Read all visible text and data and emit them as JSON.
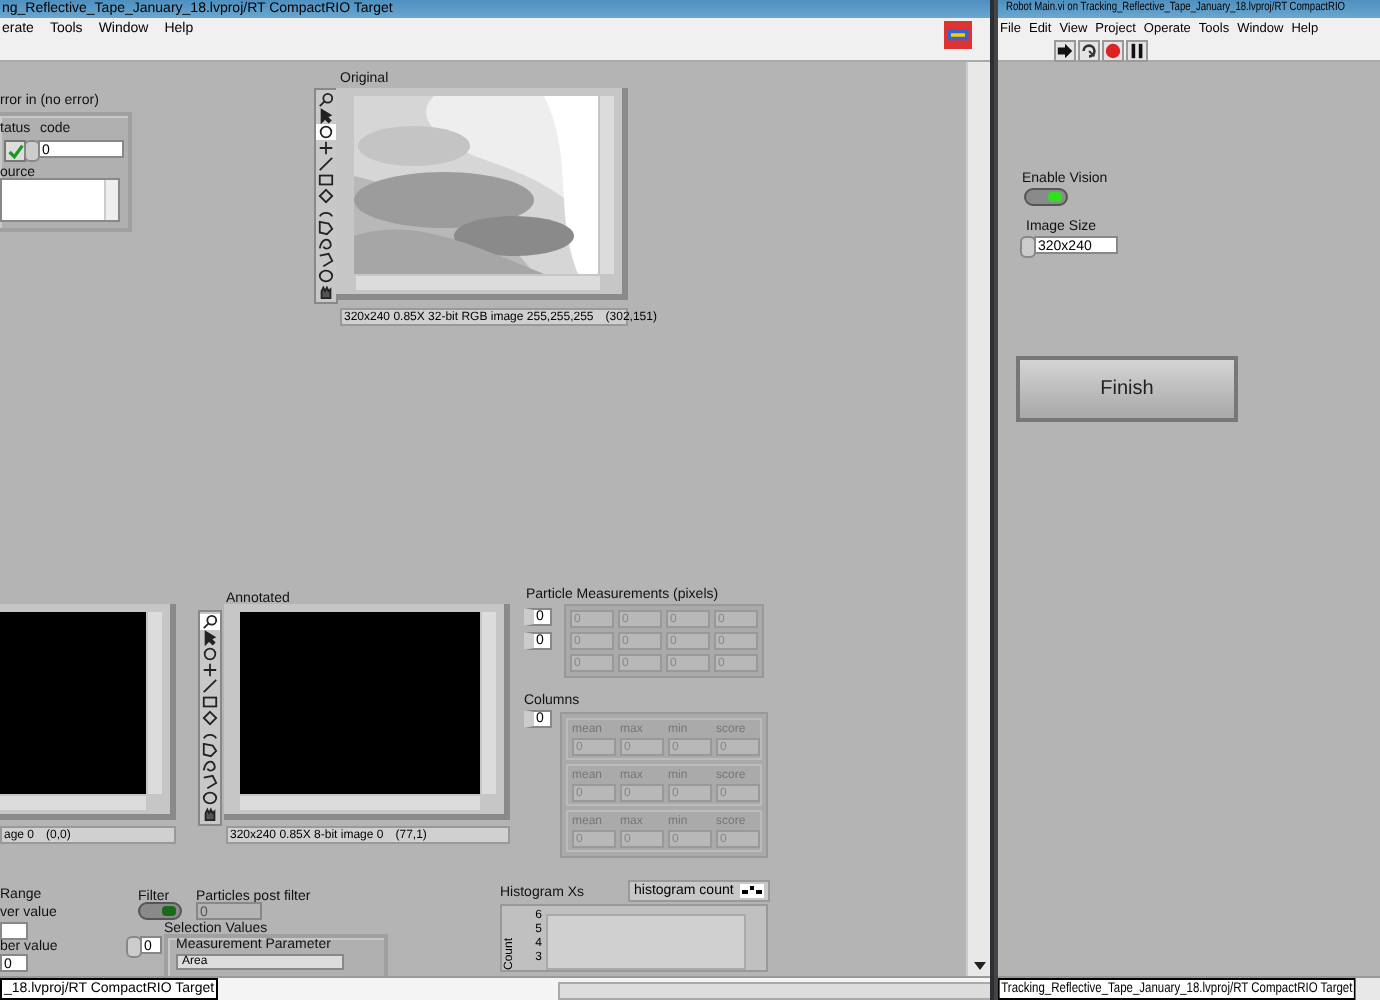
{
  "left_window": {
    "title": "ng_Reflective_Tape_January_18.lvproj/RT CompactRIO Target",
    "menu": [
      "erate",
      "Tools",
      "Window",
      "Help"
    ],
    "status": "_18.lvproj/RT CompactRIO Target"
  },
  "error_in": {
    "label": "rror in (no error)",
    "status_label": "tatus",
    "code_label": "code",
    "status": true,
    "code": "0",
    "source_label": "ource"
  },
  "original": {
    "label": "Original",
    "info": "320x240 0.85X 32-bit RGB image 255,255,255",
    "coords": "(302,151)",
    "tools": [
      {
        "kind": "zoom",
        "selected": false
      },
      {
        "kind": "pointer",
        "selected": false
      },
      {
        "kind": "pan",
        "selected": true
      },
      {
        "kind": "point",
        "selected": false
      },
      {
        "kind": "line",
        "selected": false
      },
      {
        "kind": "rectangle",
        "selected": false
      },
      {
        "kind": "rotated",
        "selected": false
      },
      {
        "kind": "annulus",
        "selected": false
      },
      {
        "kind": "polygon",
        "selected": false
      },
      {
        "kind": "freehand",
        "selected": false
      },
      {
        "kind": "broken",
        "selected": false
      },
      {
        "kind": "oval",
        "selected": false
      },
      {
        "kind": "hand",
        "selected": false
      }
    ]
  },
  "left_display": {
    "info": "age 0",
    "coords": "(0,0)"
  },
  "annotated": {
    "label": "Annotated",
    "info": "320x240 0.85X 8-bit image 0",
    "coords": "(77,1)",
    "tools": [
      {
        "kind": "zoom",
        "selected": true
      },
      {
        "kind": "pointer",
        "selected": false
      },
      {
        "kind": "pan",
        "selected": false
      },
      {
        "kind": "point",
        "selected": false
      },
      {
        "kind": "line",
        "selected": false
      },
      {
        "kind": "rectangle",
        "selected": false
      },
      {
        "kind": "rotated",
        "selected": false
      },
      {
        "kind": "annulus",
        "selected": false
      },
      {
        "kind": "polygon",
        "selected": false
      },
      {
        "kind": "freehand",
        "selected": false
      },
      {
        "kind": "broken",
        "selected": false
      },
      {
        "kind": "oval",
        "selected": false
      },
      {
        "kind": "hand",
        "selected": false
      }
    ]
  },
  "particle_measurements": {
    "label": "Particle Measurements (pixels)",
    "indices": [
      "0",
      "0"
    ],
    "rows": [
      [
        "0",
        "0",
        "0",
        "0"
      ],
      [
        "0",
        "0",
        "0",
        "0"
      ],
      [
        "0",
        "0",
        "0",
        "0"
      ]
    ]
  },
  "columns": {
    "label": "Columns",
    "index": "0",
    "blocks": [
      {
        "headers": [
          "mean",
          "max",
          "min",
          "score"
        ],
        "values": [
          "0",
          "0",
          "0",
          "0"
        ]
      },
      {
        "headers": [
          "mean",
          "max",
          "min",
          "score"
        ],
        "values": [
          "0",
          "0",
          "0",
          "0"
        ]
      },
      {
        "headers": [
          "mean",
          "max",
          "min",
          "score"
        ],
        "values": [
          "0",
          "0",
          "0",
          "0"
        ]
      }
    ]
  },
  "range": {
    "label": "Range",
    "upper_label": "ver value",
    "lower_label": "ber value",
    "lower": "0"
  },
  "filter": {
    "label": "Filter",
    "on": true
  },
  "particles_post_filter": {
    "label": "Particles post filter",
    "value": "0"
  },
  "selection_values": {
    "index": "0",
    "label": "Selection Values",
    "parameter_label": "Measurement Parameter",
    "parameter": "Area"
  },
  "histogram": {
    "title": "Histogram Xs",
    "legend": "histogram count",
    "y_axis_label": "Count",
    "y_ticks": [
      "6",
      "5",
      "4",
      "3"
    ]
  },
  "right_window": {
    "title": "Robot Main.vi on Tracking_Reflective_Tape_January_18.lvproj/RT CompactRIO",
    "menu": [
      "File",
      "Edit",
      "View",
      "Project",
      "Operate",
      "Tools",
      "Window",
      "Help"
    ],
    "status": "Tracking_Reflective_Tape_January_18.lvproj/RT CompactRIO Target",
    "enable_vision": {
      "label": "Enable Vision",
      "on": true
    },
    "image_size": {
      "label": "Image Size",
      "value": "320x240"
    },
    "finish": "Finish"
  }
}
